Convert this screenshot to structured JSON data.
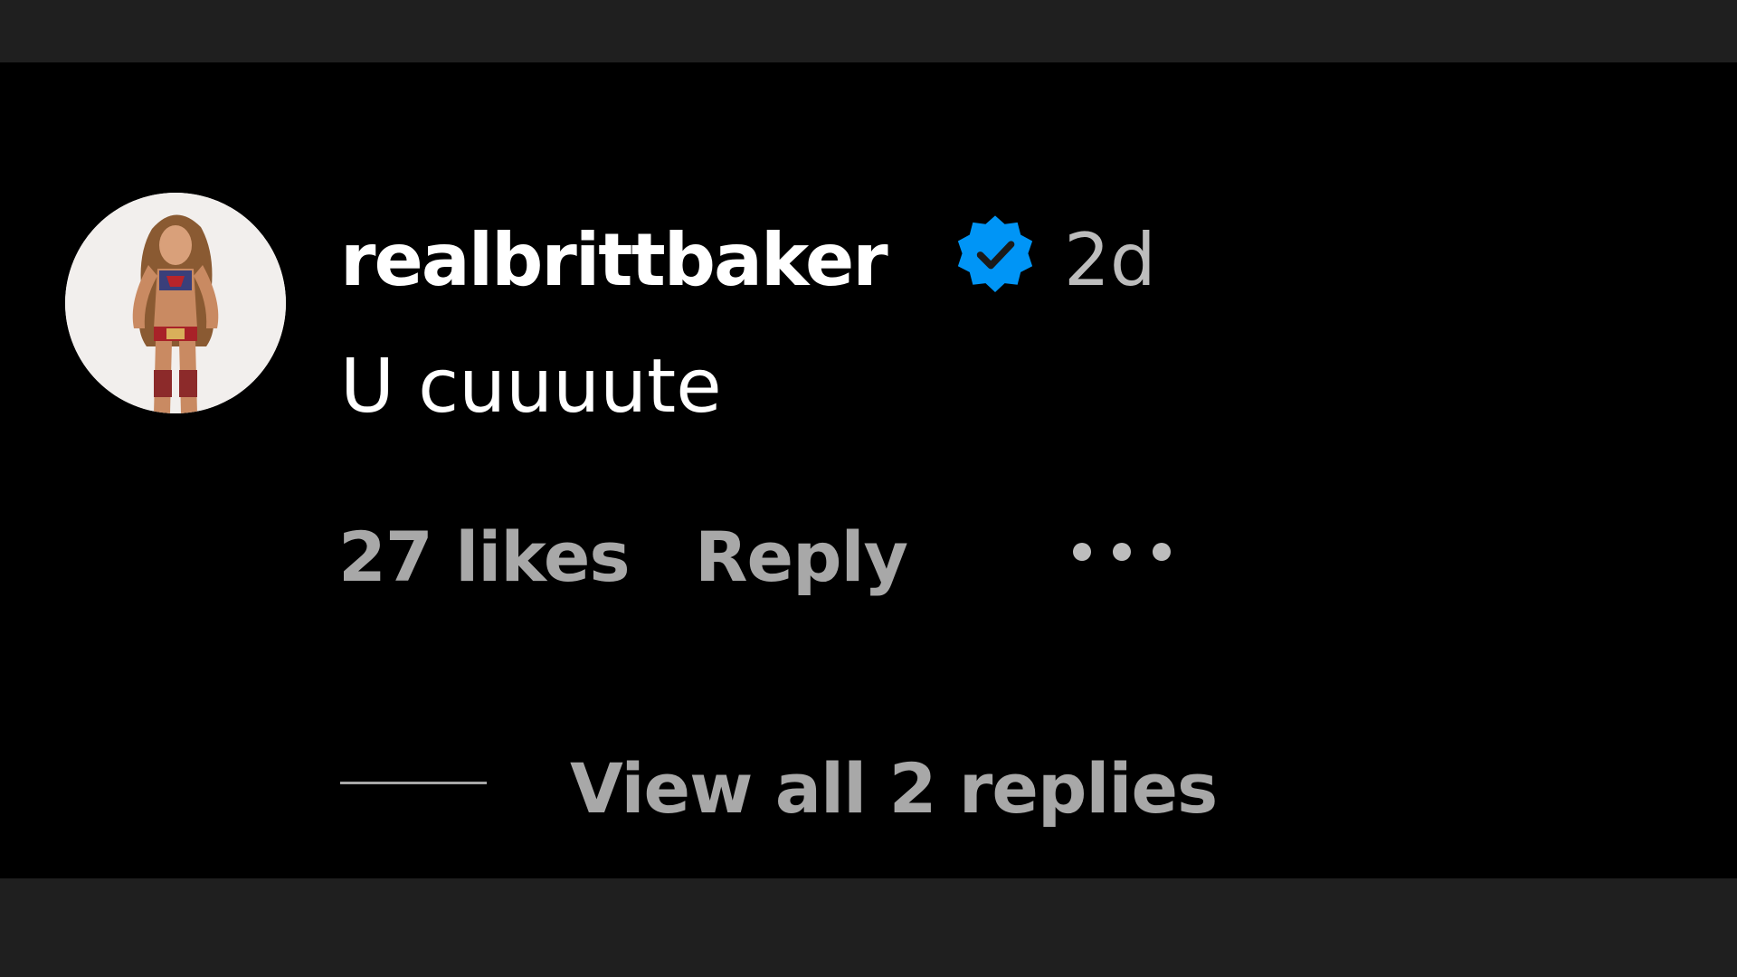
{
  "comment": {
    "username": "realbrittbaker",
    "verified_icon": "verified-badge-icon",
    "timestamp": "2d",
    "text": "U cuuuute",
    "likes_label": "27 likes",
    "reply_label": "Reply",
    "more_icon": "more-options-icon",
    "view_replies_label": "View all 2 replies"
  },
  "colors": {
    "background": "#000000",
    "letterbox": "#1f1f1f",
    "primary_text": "#ffffff",
    "secondary_text": "#a8a8a8",
    "verified_blue": "#0095f6"
  }
}
